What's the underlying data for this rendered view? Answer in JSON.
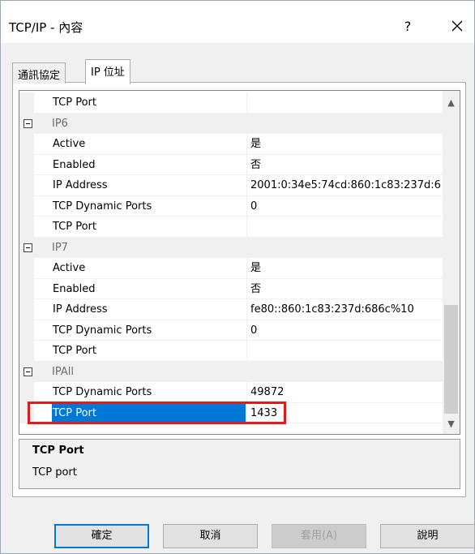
{
  "window": {
    "title": "TCP/IP - 內容",
    "help_label": "?"
  },
  "tabs": [
    {
      "label": "通訊協定",
      "active": false
    },
    {
      "label": "IP 位址",
      "active": true
    }
  ],
  "grid": {
    "rows": [
      {
        "type": "prop",
        "name": "TCP Port",
        "value": ""
      },
      {
        "type": "cat",
        "label": "IP6"
      },
      {
        "type": "prop",
        "name": "Active",
        "value": "是"
      },
      {
        "type": "prop",
        "name": "Enabled",
        "value": "否"
      },
      {
        "type": "prop",
        "name": "IP Address",
        "value": "2001:0:34e5:74cd:860:1c83:237d:6"
      },
      {
        "type": "prop",
        "name": "TCP Dynamic Ports",
        "value": "0"
      },
      {
        "type": "prop",
        "name": "TCP Port",
        "value": ""
      },
      {
        "type": "cat",
        "label": "IP7"
      },
      {
        "type": "prop",
        "name": "Active",
        "value": "是"
      },
      {
        "type": "prop",
        "name": "Enabled",
        "value": "否"
      },
      {
        "type": "prop",
        "name": "IP Address",
        "value": "fe80::860:1c83:237d:686c%10"
      },
      {
        "type": "prop",
        "name": "TCP Dynamic Ports",
        "value": "0"
      },
      {
        "type": "prop",
        "name": "TCP Port",
        "value": ""
      },
      {
        "type": "cat",
        "label": "IPAll"
      },
      {
        "type": "prop",
        "name": "TCP Dynamic Ports",
        "value": "49872"
      },
      {
        "type": "prop",
        "name": "TCP Port",
        "value": "1433",
        "selected": true
      }
    ]
  },
  "description": {
    "title": "TCP Port",
    "text": "TCP port"
  },
  "buttons": {
    "ok": "確定",
    "cancel": "取消",
    "apply": "套用(A)",
    "help": "說明"
  },
  "colors": {
    "selection": "#0078d7",
    "highlight_box": "#e01b1b"
  }
}
